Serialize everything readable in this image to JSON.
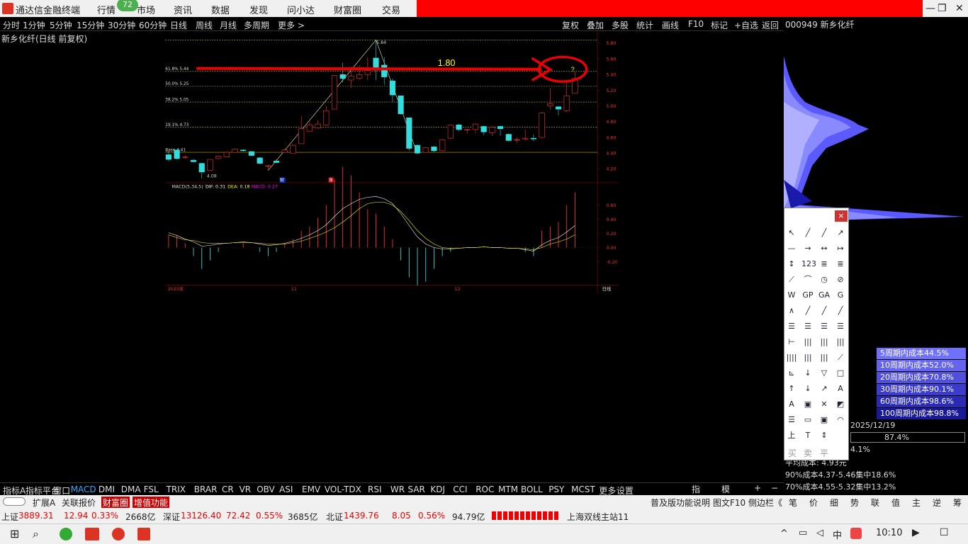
{
  "app": {
    "title": "通达信金融终端",
    "badge": "72",
    "menus": [
      "行情",
      "市场",
      "资讯",
      "数据",
      "发现",
      "问小达",
      "财富圈",
      "交易"
    ]
  },
  "periods": [
    "分时",
    "1分钟",
    "5分钟",
    "15分钟",
    "30分钟",
    "60分钟",
    "日线",
    "周线",
    "月线",
    "多周期",
    "更多 >"
  ],
  "toolbar": [
    "复权",
    "叠加",
    "多股",
    "统计",
    "画线",
    "F10",
    "标记",
    "+自选",
    "返回"
  ],
  "stock": {
    "code": "000949 新乡化纤",
    "chart_title": "新乡化纤(日线 前复权)"
  },
  "levels": [
    {
      "label": "61.8% 5.44",
      "price": 5.44
    },
    {
      "label": "50.0% 5.25",
      "price": 5.25
    },
    {
      "label": "38.2% 5.05",
      "price": 5.05
    },
    {
      "label": "19.1% 4.73",
      "price": 4.73
    },
    {
      "label": "Base 4.41",
      "price": 4.41
    }
  ],
  "annot": {
    "big": "1.80",
    "q": "?",
    "high": "5.84",
    "low": "4.08",
    "cai": "财",
    "zhang": "涨"
  },
  "price_axis": [
    "5.80",
    "5.60",
    "5.40",
    "5.20",
    "5.00",
    "4.80",
    "4.60",
    "4.40",
    "4.20"
  ],
  "macd": {
    "title": "MACD(5,34,5)",
    "dif": "DIF: 0.31",
    "dea": "DEA: 0.18",
    "macd": "MACD: 0.27",
    "axis": [
      "0.60",
      "0.40",
      "0.20",
      "0.00",
      "-0.20"
    ]
  },
  "xaxis": [
    "2025年",
    "11",
    "12"
  ],
  "xaxis_right": "日线",
  "indicators": [
    "指标A",
    "指标平台",
    "窗口",
    "MACD",
    "DMI",
    "DMA",
    "FSL",
    "TRIX",
    "BRAR",
    "CR",
    "VR",
    "OBV",
    "ASI",
    "EMV",
    "VOL-TDX",
    "RSI",
    "WR",
    "SAR",
    "KDJ",
    "CCI",
    "ROC",
    "MTM",
    "BOLL",
    "PSY",
    "MCST",
    "更多",
    "设置"
  ],
  "ind_right": [
    "指标B",
    "模 板",
    "+",
    "−"
  ],
  "costs": [
    "5周期内成本44.5%",
    "10周期内成本52.0%",
    "20周期内成本70.8%",
    "30周期内成本90.1%",
    "60周期内成本98.6%",
    "100周期内成本98.8%"
  ],
  "chip": {
    "date": "2025/12/19",
    "pct": "87.4%",
    "pct2": "4.1%",
    "avg": "平均成本: 4.93元",
    "c90": "90%成本4.37-5.46集中18.6%",
    "c70": "70%成本4.55-5.32集中13.2%"
  },
  "toolbox_bottom": [
    "买",
    "卖",
    "平"
  ],
  "ext": {
    "left": [
      "扩展A",
      "关联报价",
      "财富圈",
      "增值功能"
    ],
    "right": [
      "普及版功能说明",
      "图文F10",
      "侧边栏《",
      "笔",
      "价",
      "细",
      "势",
      "联",
      "值",
      "主",
      "逆",
      "筹"
    ]
  },
  "status": {
    "sh": {
      "name": "上证",
      "val": "3889.31",
      "chg": "12.94",
      "pct": "0.33%",
      "amt": "2668亿"
    },
    "sz": {
      "name": "深证",
      "val": "13126.40",
      "chg": "72.42",
      "pct": "0.55%",
      "amt": "3685亿"
    },
    "bj": {
      "name": "北证",
      "val": "1439.76",
      "chg": "8.05",
      "pct": "0.56%",
      "amt": "94.79亿"
    },
    "station": "上海双线主站11"
  },
  "clock": "10:10",
  "chart_data": {
    "type": "candlestick",
    "candles": [
      [
        4.38,
        4.32,
        4.44,
        4.3
      ],
      [
        4.44,
        4.33,
        4.45,
        4.32
      ],
      [
        4.35,
        4.35,
        4.37,
        4.33
      ],
      [
        4.31,
        4.29,
        4.33,
        4.28
      ],
      [
        4.27,
        4.16,
        4.28,
        4.08
      ],
      [
        4.18,
        4.32,
        4.32,
        4.18
      ],
      [
        4.33,
        4.36,
        4.37,
        4.32
      ],
      [
        4.35,
        4.41,
        4.42,
        4.35
      ],
      [
        4.41,
        4.45,
        4.46,
        4.4
      ],
      [
        4.44,
        4.43,
        4.45,
        4.42
      ],
      [
        4.42,
        4.37,
        4.43,
        4.36
      ],
      [
        4.34,
        4.27,
        4.35,
        4.26
      ],
      [
        4.24,
        4.24,
        4.25,
        4.18
      ],
      [
        4.3,
        4.28,
        4.32,
        4.27
      ],
      [
        4.41,
        4.44,
        4.45,
        4.4
      ],
      [
        4.4,
        4.5,
        4.51,
        4.4
      ],
      [
        4.52,
        4.71,
        4.87,
        4.52
      ],
      [
        4.68,
        4.76,
        4.8,
        4.67
      ],
      [
        4.72,
        4.77,
        4.82,
        4.71
      ],
      [
        4.76,
        4.94,
        5.0,
        4.75
      ],
      [
        4.96,
        5.39,
        5.39,
        4.96
      ],
      [
        5.4,
        5.35,
        5.55,
        5.3
      ],
      [
        5.33,
        5.38,
        5.5,
        5.23
      ],
      [
        5.35,
        5.4,
        5.52,
        5.33
      ],
      [
        5.4,
        5.45,
        5.62,
        5.33
      ],
      [
        5.61,
        5.49,
        5.84,
        5.33
      ],
      [
        5.52,
        5.37,
        5.62,
        5.27
      ],
      [
        5.32,
        5.14,
        5.35,
        5.05
      ],
      [
        5.13,
        4.9,
        5.13,
        4.89
      ],
      [
        4.85,
        4.46,
        4.85,
        4.43
      ],
      [
        4.5,
        4.4,
        4.51,
        4.39
      ],
      [
        4.41,
        4.47,
        4.48,
        4.4
      ],
      [
        4.48,
        4.43,
        4.49,
        4.41
      ],
      [
        4.43,
        4.57,
        4.58,
        4.42
      ],
      [
        4.59,
        4.76,
        4.77,
        4.58
      ],
      [
        4.76,
        4.7,
        4.77,
        4.68
      ],
      [
        4.7,
        4.7,
        4.71,
        4.65
      ],
      [
        4.7,
        4.77,
        4.78,
        4.65
      ],
      [
        4.74,
        4.67,
        4.75,
        4.63
      ],
      [
        4.66,
        4.73,
        4.74,
        4.62
      ],
      [
        4.74,
        4.71,
        4.75,
        4.62
      ],
      [
        4.64,
        4.56,
        4.65,
        4.55
      ],
      [
        4.57,
        4.57,
        4.6,
        4.53
      ],
      [
        4.58,
        4.59,
        4.7,
        4.56
      ],
      [
        4.59,
        4.58,
        4.64,
        4.55
      ],
      [
        4.6,
        4.91,
        4.92,
        4.59
      ],
      [
        5.0,
        5.03,
        5.23,
        4.95
      ],
      [
        4.99,
        4.96,
        5.0,
        4.88
      ],
      [
        4.94,
        5.13,
        5.33,
        4.92
      ],
      [
        5.16,
        5.35,
        5.44,
        5.16
      ]
    ],
    "candle_format": "[open, close, high, low]",
    "ylim": [
      4.05,
      5.9
    ],
    "macd_dif": [
      0.21,
      0.17,
      0.12,
      0.08,
      0.02,
      0.03,
      0.05,
      0.06,
      0.07,
      0.08,
      0.07,
      0.05,
      0.03,
      0.04,
      0.06,
      0.09,
      0.13,
      0.18,
      0.24,
      0.32,
      0.44,
      0.55,
      0.62,
      0.68,
      0.71,
      0.72,
      0.69,
      0.62,
      0.48,
      0.31,
      0.15,
      0.05,
      0.0,
      -0.02,
      -0.02,
      -0.01,
      0.0,
      0.0,
      0.01,
      0.0,
      0.0,
      -0.01,
      -0.01,
      -0.03,
      -0.05,
      0.04,
      0.1,
      0.14,
      0.22,
      0.31
    ],
    "macd_dea": [
      0.18,
      0.14,
      0.11,
      0.1,
      0.07,
      0.06,
      0.06,
      0.06,
      0.07,
      0.07,
      0.07,
      0.06,
      0.05,
      0.05,
      0.05,
      0.07,
      0.09,
      0.13,
      0.17,
      0.22,
      0.28,
      0.36,
      0.45,
      0.55,
      0.62,
      0.64,
      0.64,
      0.6,
      0.51,
      0.38,
      0.24,
      0.13,
      0.05,
      0.0,
      -0.01,
      -0.01,
      0.0,
      0.0,
      0.01,
      0.0,
      0.0,
      -0.01,
      -0.01,
      -0.02,
      -0.03,
      0.0,
      0.05,
      0.08,
      0.12,
      0.18
    ],
    "macd_ylim": [
      -0.5,
      0.8
    ]
  }
}
